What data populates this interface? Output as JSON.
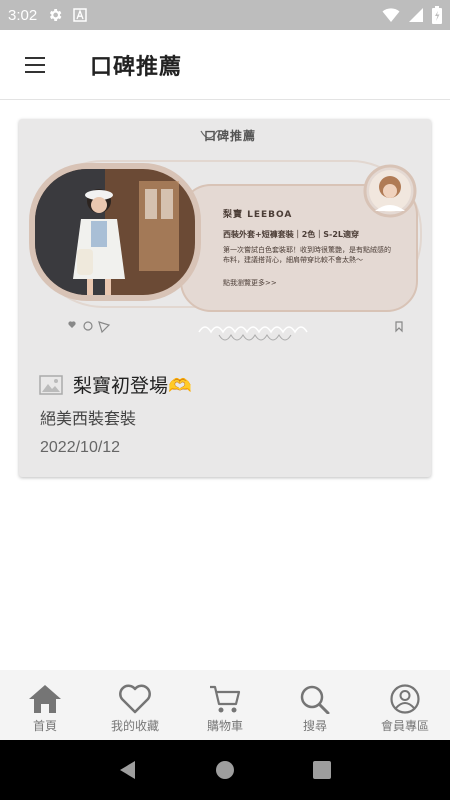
{
  "status_bar": {
    "time": "3:02"
  },
  "app_bar": {
    "title": "口碑推薦"
  },
  "post": {
    "promo_header": "口碑推薦",
    "promo_brand": "梨寶  LEEBOA",
    "promo_product": "西裝外套+短褲套裝｜2色｜S-2L適穿",
    "promo_desc": "第一次嘗試白色套裝耶！收到時很驚艷，是有點絨感的布料，建議搭背心，細肩帶穿比較不會太熱～",
    "promo_more": "點我瀏覽更多>>",
    "title": "梨寶初登場🫶",
    "subtitle": "絕美西裝套裝",
    "date": "2022/10/12"
  },
  "bottom_nav": {
    "items": [
      {
        "label": "首頁",
        "icon": "home-icon"
      },
      {
        "label": "我的收藏",
        "icon": "heart-icon"
      },
      {
        "label": "購物車",
        "icon": "cart-icon"
      },
      {
        "label": "搜尋",
        "icon": "search-icon"
      },
      {
        "label": "會員專區",
        "icon": "account-icon"
      }
    ]
  },
  "colors": {
    "status_bar": "#bdbdbd",
    "card_bg": "#e9e8e8",
    "promo_frame": "#d8c3b6",
    "promo_panel": "#e4d9d3",
    "nav_icon": "#757575"
  }
}
